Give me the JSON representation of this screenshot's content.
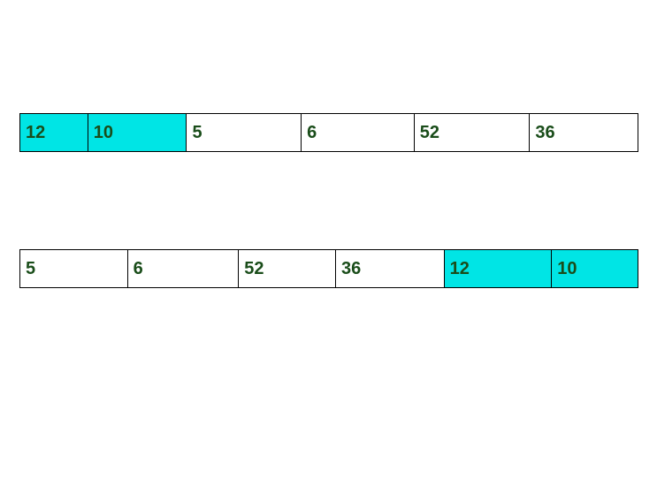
{
  "arrays": {
    "row1": {
      "cells": [
        {
          "value": "12",
          "highlighted": true
        },
        {
          "value": "10",
          "highlighted": true
        },
        {
          "value": "5",
          "highlighted": false
        },
        {
          "value": "6",
          "highlighted": false
        },
        {
          "value": "52",
          "highlighted": false
        },
        {
          "value": "36",
          "highlighted": false
        }
      ]
    },
    "row2": {
      "cells": [
        {
          "value": "5",
          "highlighted": false
        },
        {
          "value": "6",
          "highlighted": false
        },
        {
          "value": "52",
          "highlighted": false
        },
        {
          "value": "36",
          "highlighted": false
        },
        {
          "value": "12",
          "highlighted": true
        },
        {
          "value": "10",
          "highlighted": true
        }
      ]
    }
  },
  "colors": {
    "highlight": "#00e5e5",
    "text": "#1a4d1a",
    "border": "#000000"
  }
}
